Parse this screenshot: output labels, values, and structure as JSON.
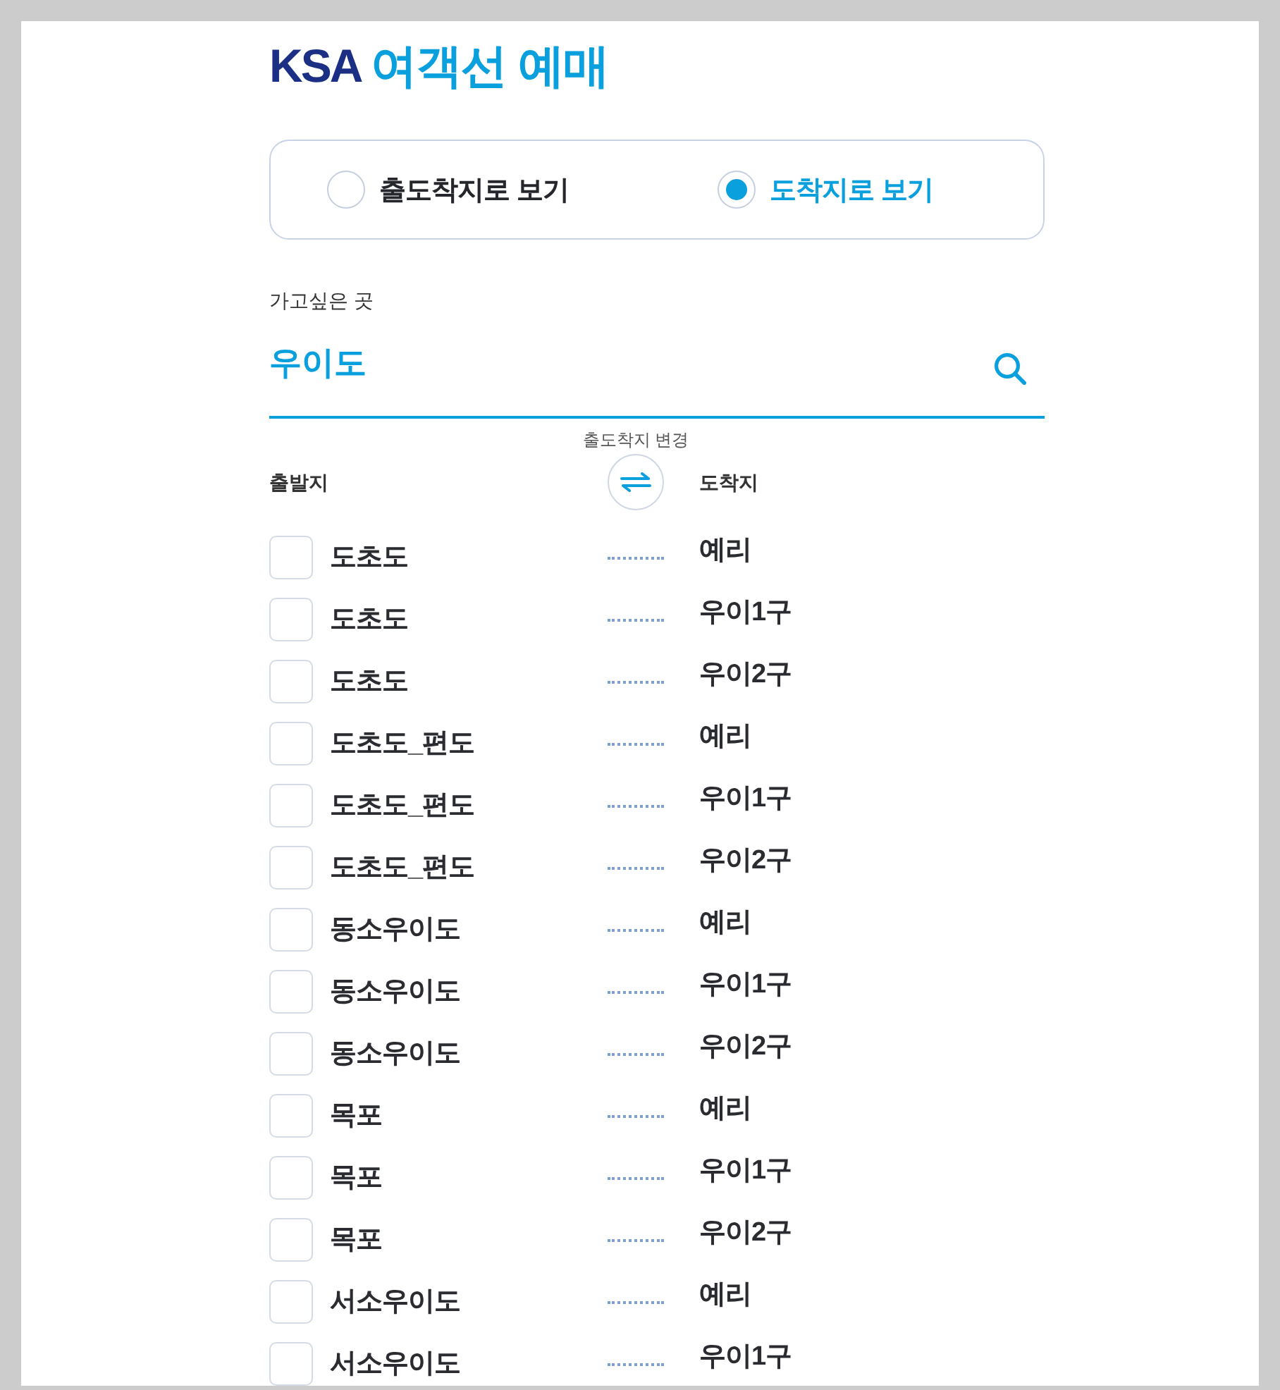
{
  "header": {
    "brand": "KSA",
    "title": "여객선 예매"
  },
  "view_options": [
    {
      "label": "출도착지로 보기",
      "selected": false
    },
    {
      "label": "도착지로 보기",
      "selected": true
    }
  ],
  "search": {
    "label": "가고싶은 곳",
    "value": "우이도"
  },
  "swap": {
    "caption": "출도착지 변경"
  },
  "columns": {
    "departure": "출발지",
    "arrival": "도착지"
  },
  "routes": [
    {
      "departure": "도초도",
      "arrival": "예리",
      "checked": false
    },
    {
      "departure": "도초도",
      "arrival": "우이1구",
      "checked": false
    },
    {
      "departure": "도초도",
      "arrival": "우이2구",
      "checked": false
    },
    {
      "departure": "도초도_편도",
      "arrival": "예리",
      "checked": false
    },
    {
      "departure": "도초도_편도",
      "arrival": "우이1구",
      "checked": false
    },
    {
      "departure": "도초도_편도",
      "arrival": "우이2구",
      "checked": false
    },
    {
      "departure": "동소우이도",
      "arrival": "예리",
      "checked": false
    },
    {
      "departure": "동소우이도",
      "arrival": "우이1구",
      "checked": false
    },
    {
      "departure": "동소우이도",
      "arrival": "우이2구",
      "checked": false
    },
    {
      "departure": "목포",
      "arrival": "예리",
      "checked": false
    },
    {
      "departure": "목포",
      "arrival": "우이1구",
      "checked": false
    },
    {
      "departure": "목포",
      "arrival": "우이2구",
      "checked": false
    },
    {
      "departure": "서소우이도",
      "arrival": "예리",
      "checked": false
    },
    {
      "departure": "서소우이도",
      "arrival": "우이1구",
      "checked": false
    }
  ]
}
